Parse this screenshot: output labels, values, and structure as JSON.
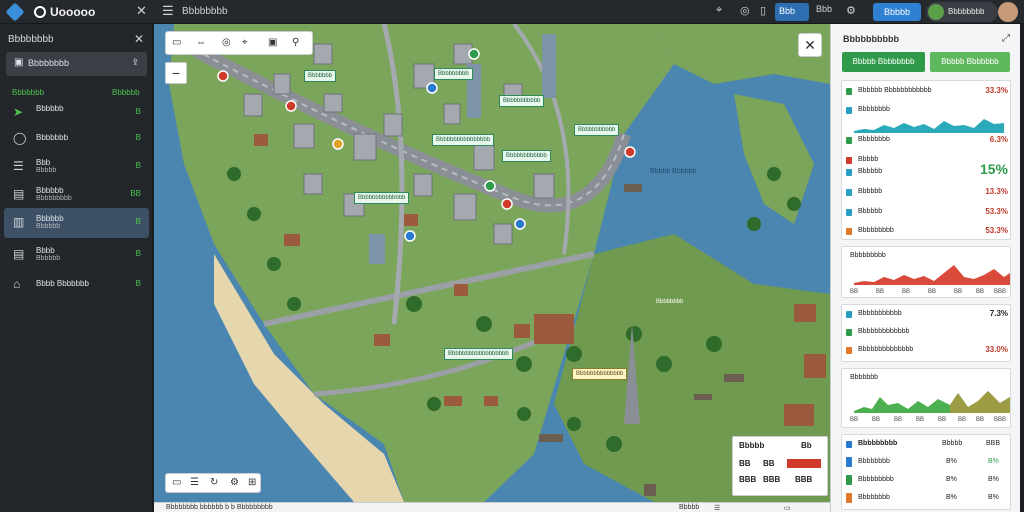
{
  "topbar": {
    "app_name": "Uooooo",
    "title": "Bbbbbbbb",
    "active_tab": "Bbb",
    "zoom_text": "Bbb",
    "primary_button": "Bbbbb",
    "user_name": "Bbbbbbbb"
  },
  "sidebar": {
    "header": "Bbbbbbbb",
    "search_label": "Bbbbbbbb",
    "stat_left": "Bbbbbbb",
    "stat_right": "Bbbbbb",
    "items": [
      {
        "line1": "Bbbbbb",
        "line2": "",
        "count": "B"
      },
      {
        "line1": "Bbbbbbb",
        "line2": "",
        "count": "B"
      },
      {
        "line1": "Bbb",
        "line2": "Bbbbb",
        "count": "B"
      },
      {
        "line1": "Bbbbbb",
        "line2": "Bbbbbbbbb",
        "count": "BB"
      },
      {
        "line1": "Bbbbbb",
        "line2": "Bbbbbb",
        "count": "B"
      },
      {
        "line1": "Bbbb",
        "line2": "Bbbbbb",
        "count": "B"
      },
      {
        "line1": "Bbbb Bbbbbbb",
        "line2": "",
        "count": "B"
      }
    ]
  },
  "map": {
    "toolbar_icons": [
      "layers-icon",
      "move-icon",
      "target-icon",
      "pin-icon",
      "route-icon"
    ],
    "labels": [
      {
        "text": "Bbbbbbb",
        "style": "g"
      },
      {
        "text": "Bbbbbbbbb",
        "style": "g"
      },
      {
        "text": "Bbbbbbbbbbb",
        "style": "g"
      },
      {
        "text": "Bbbbbbbbbbb",
        "style": "g"
      },
      {
        "text": "Bbbbbbbbbbbbbbbb",
        "style": "g"
      },
      {
        "text": "Bbbbbbbbbbbb",
        "style": "g"
      },
      {
        "text": "Bbbbbbbbbbbbbb",
        "style": "y"
      },
      {
        "text": "Bbbbbbbbbbbbbb",
        "style": "g"
      },
      {
        "text": "Bbbbbbbbbbbbbbbbbb",
        "style": "g"
      }
    ],
    "water_label_1": "Bbbbb Bbbbbb",
    "water_label_2": "Bbbbbbbb",
    "popup": {
      "r1a": "Bbbbb",
      "r1b": "Bb",
      "r2a": "BB",
      "r2b": "BB",
      "r3a": "BBB",
      "r3b": "BBB",
      "r3c": "BBB"
    },
    "status_text": "Bbbbbbbb bbbbbb b b Bbbbbbbbb",
    "status_right": "Bbbbb"
  },
  "right_panel": {
    "title": "Bbbbbbbbbb",
    "button_primary": "Bbbbb Bbbbbbbb",
    "button_secondary": "Bbbbb Bbbbbbb",
    "group1": [
      {
        "label": "Bbbbbb Bbbbbbbbbbbb",
        "value": "33.3%",
        "color": "#2e9a4a",
        "value_color": "#c0392b"
      },
      {
        "label": "Bbbbbbbb",
        "value": "",
        "color": "#2a9ec2",
        "value_color": "#222"
      },
      {
        "label": "Bbbbbbbb",
        "value": "6.3%",
        "color": "#2e9a4a",
        "value_color": "#c0392b"
      },
      {
        "label": "Bbbbb",
        "value": "",
        "color": "#d03a2a",
        "value_color": "#222"
      },
      {
        "label": "Bbbbbb",
        "value": "15%",
        "color": "#2a9ec2",
        "value_color": "#2e9a4a"
      },
      {
        "label": "Bbbbbb",
        "value": "13.3%",
        "color": "#2a9ec2",
        "value_color": "#c0392b"
      },
      {
        "label": "Bbbbbb",
        "value": "53.3%",
        "color": "#2a9ec2",
        "value_color": "#c0392b"
      },
      {
        "label": "Bbbbbbbbb",
        "value": "53.3%",
        "color": "#e07a2a",
        "value_color": "#c0392b"
      }
    ],
    "chart1_title": "Bbbbbbbbb",
    "chart1_ticks": [
      "BB",
      "BB",
      "BB",
      "BB",
      "BB",
      "BB",
      "BBB"
    ],
    "group2": [
      {
        "label": "Bbbbbbbbbbb",
        "value": "7.3%",
        "color": "#2a9ec2",
        "value_color": "#222"
      },
      {
        "label": "Bbbbbbbbbbbbb",
        "value": "",
        "color": "#2e9a4a",
        "value_color": "#222"
      },
      {
        "label": "Bbbbbbbbbbbbbb",
        "value": "33.0%",
        "color": "#e07a2a",
        "value_color": "#c0392b"
      }
    ],
    "chart2_title": "Bbbbbbb",
    "chart2_ticks": [
      "BB",
      "BB",
      "BB",
      "BB",
      "BB",
      "BB",
      "BB",
      "BBB"
    ],
    "table_header": {
      "label": "Bbbbbbbbb",
      "c1": "Bbbbb",
      "c2": "BBB"
    },
    "table_rows": [
      {
        "label": "Bbbbbbbb",
        "c1": "B%",
        "c2": "B%",
        "color": "#2a7ad0"
      },
      {
        "label": "Bbbbbbbbb",
        "c1": "B%",
        "c2": "B%",
        "color": "#2e9a4a"
      },
      {
        "label": "Bbbbbbbb",
        "c1": "B%",
        "c2": "B%",
        "color": "#e07a2a"
      }
    ]
  },
  "colors": {
    "accent": "#2f80d1",
    "success": "#2e9a4a",
    "danger": "#d03a2a",
    "water": "#4a86b0"
  }
}
